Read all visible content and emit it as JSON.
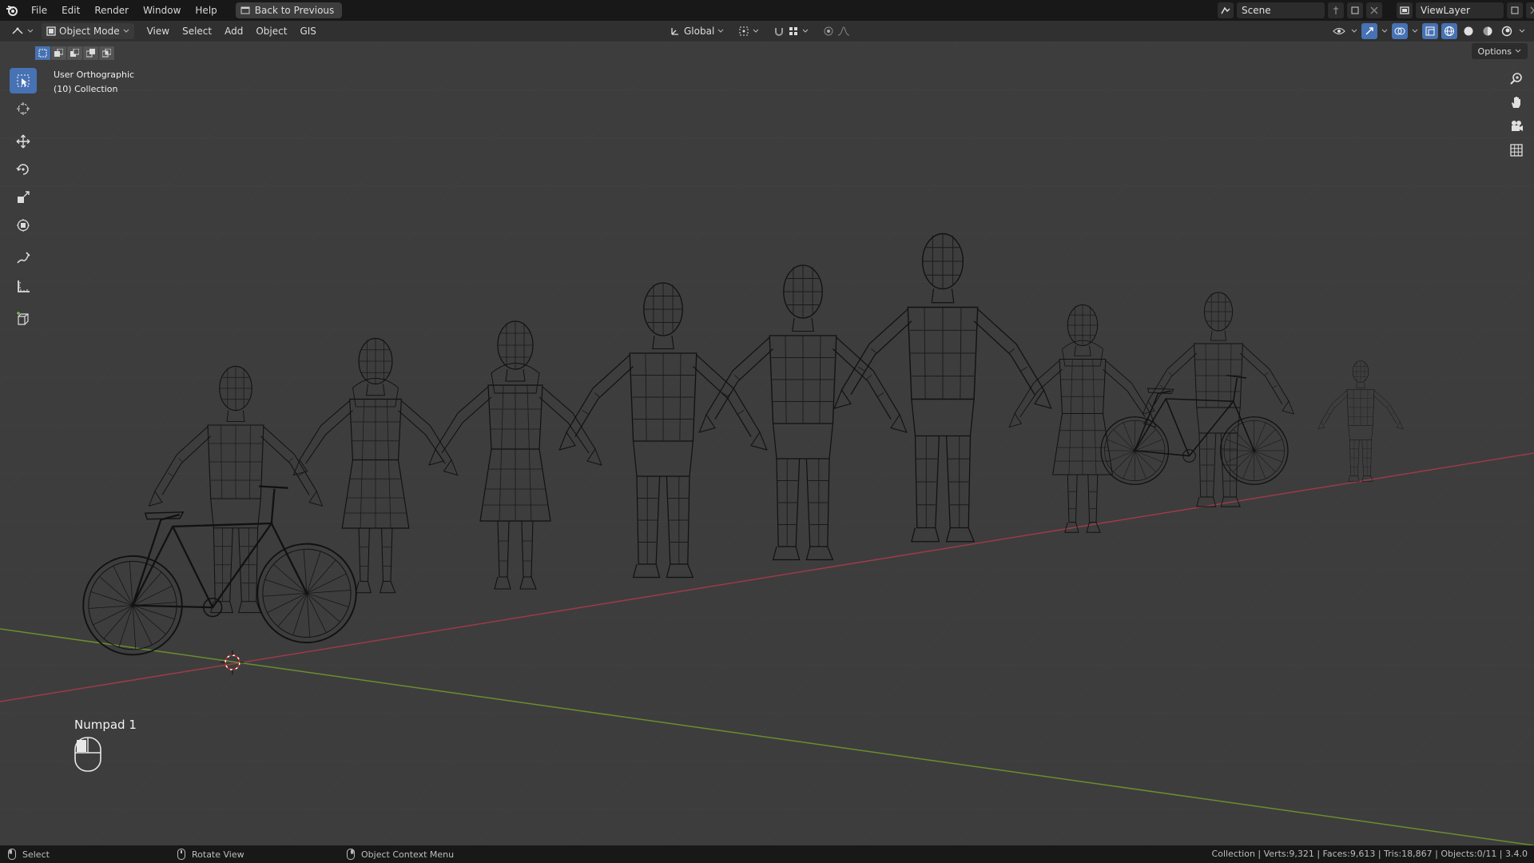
{
  "menubar": {
    "items": [
      "File",
      "Edit",
      "Render",
      "Window",
      "Help"
    ],
    "back_button": "Back to Previous",
    "scene_name": "Scene",
    "view_layer": "ViewLayer"
  },
  "viewport_header": {
    "mode": "Object Mode",
    "menus": [
      "View",
      "Select",
      "Add",
      "Object",
      "GIS"
    ],
    "transform_orientation": "Global",
    "options_label": "Options"
  },
  "viewport": {
    "view_name": "User Orthographic",
    "collection": "(10) Collection",
    "key_hint": "Numpad 1"
  },
  "status": {
    "left_action": "Select",
    "middle_action": "Rotate View",
    "right_action": "Object Context Menu",
    "stats": "Collection | Verts:9,321 | Faces:9,613 | Tris:18,867 | Objects:0/11 | 3.4.0"
  },
  "colors": {
    "accent": "#4772b3",
    "viewport_bg": "#3d3d3d",
    "x_axis": "#9b3b4a",
    "y_axis": "#6a8e2e",
    "wire": "#101010"
  },
  "icons": {
    "toolbar": [
      "select-box-icon",
      "cursor-icon",
      "move-icon",
      "rotate-icon",
      "scale-icon",
      "transform-icon",
      "annotate-icon",
      "measure-icon",
      "add-cube-icon"
    ],
    "nav": [
      "zoom-icon",
      "pan-hand-icon",
      "camera-icon",
      "grid-icon"
    ]
  }
}
